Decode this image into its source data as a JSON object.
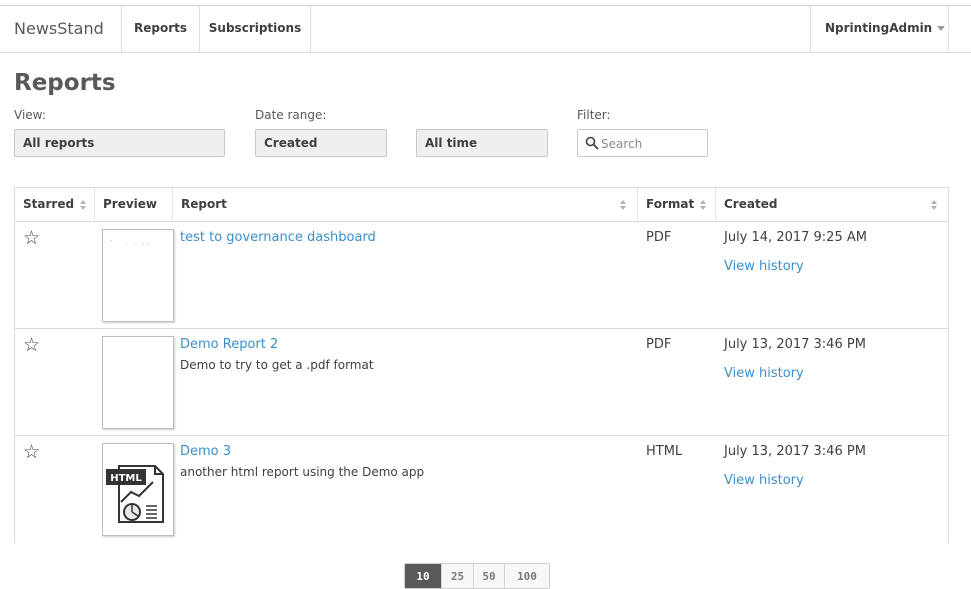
{
  "nav": {
    "brand": "NewsStand",
    "tabs": [
      {
        "label": "Reports"
      },
      {
        "label": "Subscriptions"
      }
    ],
    "user": "NprintingAdmin"
  },
  "page": {
    "title": "Reports"
  },
  "filters": {
    "view_label": "View:",
    "view_value": "All reports",
    "date_range_label": "Date range:",
    "date_field_value": "Created",
    "date_period_value": "All time",
    "filter_label": "Filter:",
    "search_placeholder": "Search"
  },
  "table": {
    "columns": [
      "Starred",
      "Preview",
      "Report",
      "Format",
      "Created"
    ],
    "rows": [
      {
        "star": "☆",
        "title": "test to governance dashboard",
        "description": "",
        "format": "PDF",
        "created": "July 14, 2017 9:25 AM",
        "history": "View history"
      },
      {
        "star": "☆",
        "title": "Demo Report 2",
        "description": "Demo to try to get a .pdf format",
        "format": "PDF",
        "created": "July 13, 2017 3:46 PM",
        "history": "View history"
      },
      {
        "star": "☆",
        "title": "Demo 3",
        "description": "another html report using the Demo app",
        "format": "HTML",
        "created": "July 13, 2017 3:46 PM",
        "history": "View history",
        "thumb_badge": "HTML"
      }
    ]
  },
  "pagination": {
    "sizes": [
      "10",
      "25",
      "50",
      "100"
    ],
    "active": "10"
  },
  "colors": {
    "link": "#3b8fc9",
    "active_page": "#595959"
  }
}
